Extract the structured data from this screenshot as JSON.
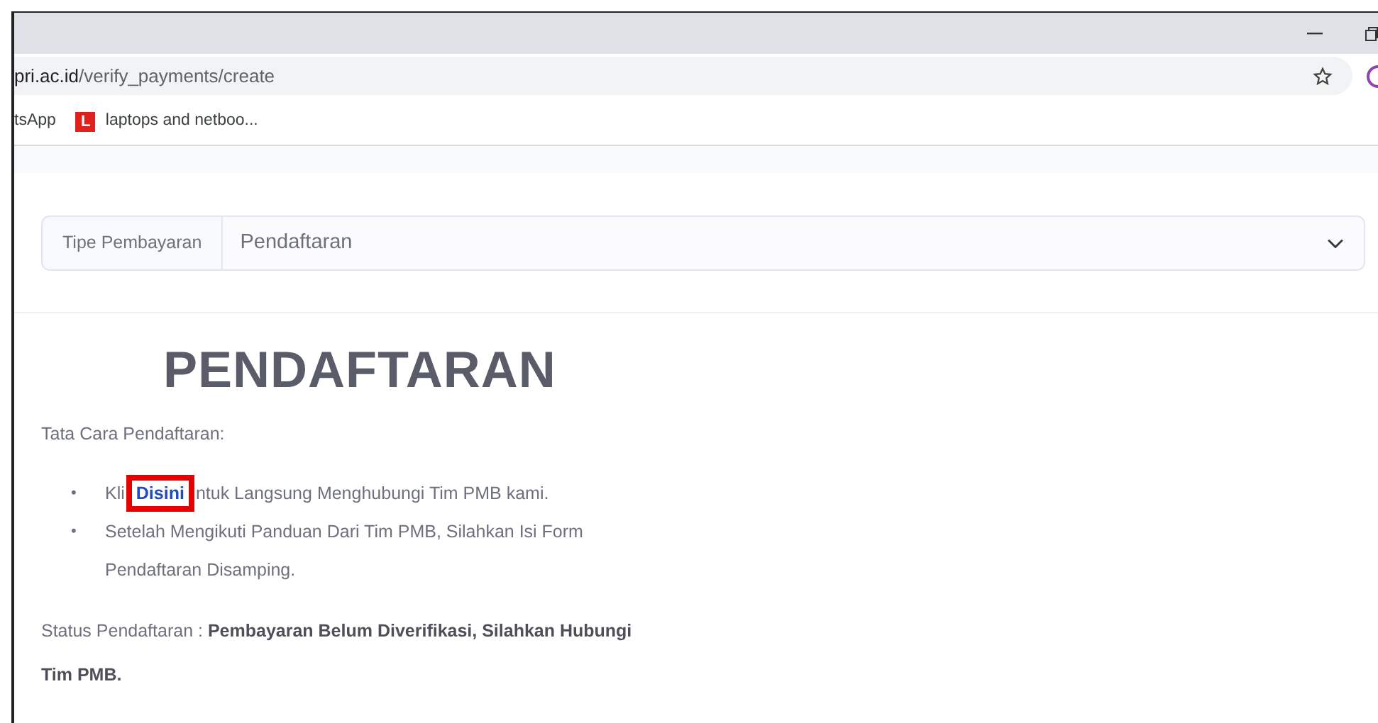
{
  "browser": {
    "address_host": "pri.ac.id",
    "address_path": "/verify_payments/create",
    "bookmarks": [
      {
        "label": "tsApp"
      },
      {
        "icon_letter": "L",
        "label": "laptops and netboo..."
      }
    ]
  },
  "payment_type": {
    "label": "Tipe Pembayaran",
    "value": "Pendaftaran"
  },
  "heading": "PENDAFTARAN",
  "intro": "Tata Cara Pendaftaran:",
  "steps": [
    {
      "kind": "link",
      "marker": "•",
      "text_before": "Kli",
      "link": "Disini",
      "text_after": "ntuk Langsung Menghubungi Tim PMB kami.",
      "highlighted": true
    },
    {
      "kind": "text",
      "marker": "•",
      "text": "Setelah Mengikuti Panduan Dari Tim PMB, Silahkan Isi Form Pendaftaran Disamping."
    }
  ],
  "status": "Status Pendaftaran : **Pembayaran Belum Diverifikasi, Silahkan Hubungi Tim PMB.**"
}
